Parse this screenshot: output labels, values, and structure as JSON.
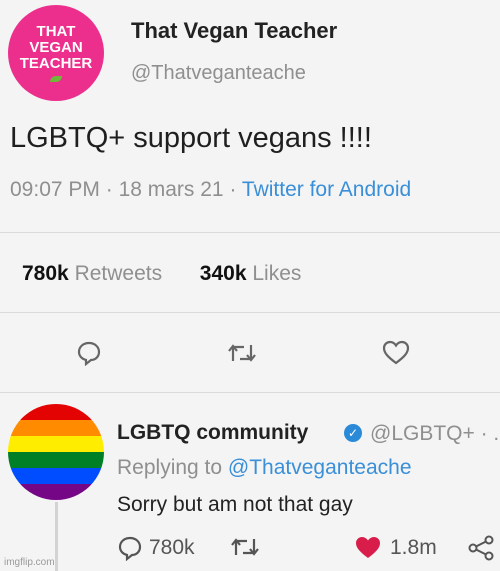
{
  "tweet": {
    "avatar_text": [
      "THAT",
      "VEGAN",
      "TEACHER"
    ],
    "author_name": "That Vegan Teacher",
    "author_handle": "@Thatveganteache",
    "text": "LGBTQ+ support vegans !!!!",
    "time": "09:07 PM",
    "date": "18 mars 21",
    "client": "Twitter for Android",
    "retweets_count": "780k",
    "retweets_label": "Retweets",
    "likes_count": "340k",
    "likes_label": "Likes"
  },
  "reply": {
    "author_name": "LGBTQ community",
    "author_handle": "@LGBTQ+ · .",
    "replying_label": "Replying to",
    "replying_to": "@Thatveganteache",
    "text": "Sorry but am not that gay",
    "replies_count": "780k",
    "likes_count": "1.8m"
  },
  "colors": {
    "vegan_pink": "#ec2f8d",
    "link_blue": "#3a8fd8",
    "heart_red": "#d91d4b",
    "rainbow": [
      "#e40303",
      "#ff8c00",
      "#ffed00",
      "#008026",
      "#004dff",
      "#750787"
    ]
  },
  "watermark": "imgflip.com"
}
